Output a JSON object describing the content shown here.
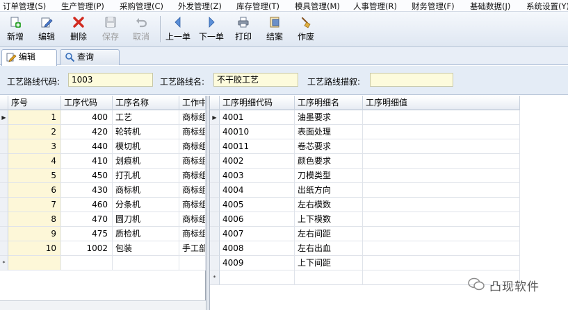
{
  "menu": [
    "订单管理(S)",
    "生产管理(P)",
    "采购管理(C)",
    "外发管理(Z)",
    "库存管理(T)",
    "模具管理(M)",
    "人事管理(R)",
    "财务管理(F)",
    "基础数据(J)",
    "系统设置(Y)"
  ],
  "toolbar": {
    "new": "新增",
    "edit": "编辑",
    "delete": "删除",
    "save": "保存",
    "cancel": "取消",
    "prev": "上一单",
    "next": "下一单",
    "print": "打印",
    "close_case": "结案",
    "void": "作废"
  },
  "tabs": {
    "edit": "编辑",
    "query": "查询"
  },
  "form": {
    "code_label": "工艺路线代码:",
    "code_value": "1003",
    "name_label": "工艺路线名:",
    "name_value": "不干胶工艺",
    "desc_label": "工艺路线描叙:",
    "desc_value": ""
  },
  "left_grid": {
    "columns": [
      "序号",
      "工序代码",
      "工序名称",
      "工作中"
    ],
    "rows": [
      [
        "1",
        "400",
        "工艺",
        "商标组"
      ],
      [
        "2",
        "420",
        "轮转机",
        "商标组"
      ],
      [
        "3",
        "440",
        "模切机",
        "商标组"
      ],
      [
        "4",
        "410",
        "划痕机",
        "商标组"
      ],
      [
        "5",
        "450",
        "打孔机",
        "商标组"
      ],
      [
        "6",
        "430",
        "商标机",
        "商标组"
      ],
      [
        "7",
        "460",
        "分条机",
        "商标组"
      ],
      [
        "8",
        "470",
        "圆刀机",
        "商标组"
      ],
      [
        "9",
        "475",
        "质检机",
        "商标组"
      ],
      [
        "10",
        "1002",
        "包装",
        "手工部"
      ]
    ]
  },
  "right_grid": {
    "columns": [
      "工序明细代码",
      "工序明细名",
      "工序明细值"
    ],
    "rows": [
      [
        "4001",
        "油墨要求",
        ""
      ],
      [
        "40010",
        "表面处理",
        ""
      ],
      [
        "40011",
        "卷芯要求",
        ""
      ],
      [
        "4002",
        "颜色要求",
        ""
      ],
      [
        "4003",
        "刀模类型",
        ""
      ],
      [
        "4004",
        "出纸方向",
        ""
      ],
      [
        "4005",
        "左右模数",
        ""
      ],
      [
        "4006",
        "上下模数",
        ""
      ],
      [
        "4007",
        "左右间距",
        ""
      ],
      [
        "4008",
        "左右出血",
        ""
      ],
      [
        "4009",
        "上下间距",
        ""
      ]
    ]
  },
  "markers": {
    "current": "▶",
    "new_row": "*"
  },
  "watermark": "凸现软件",
  "colors": {
    "input_bg": "#fdfbdc",
    "seq_bg": "#fdf7d8",
    "header_bg": "#e7ecf3"
  }
}
